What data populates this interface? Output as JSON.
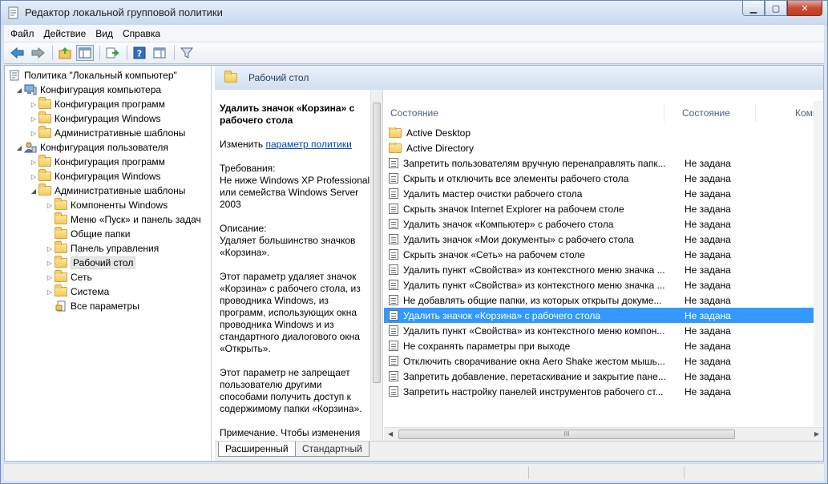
{
  "window": {
    "title": "Редактор локальной групповой политики"
  },
  "menu": {
    "file": "Файл",
    "action": "Действие",
    "view": "Вид",
    "help": "Справка"
  },
  "tree": {
    "root": "Политика \"Локальный компьютер\"",
    "computer_config": "Конфигурация компьютера",
    "cc_software": "Конфигурация программ",
    "cc_windows": "Конфигурация Windows",
    "cc_admin": "Административные шаблоны",
    "user_config": "Конфигурация пользователя",
    "uc_software": "Конфигурация программ",
    "uc_windows": "Конфигурация Windows",
    "uc_admin": "Административные шаблоны",
    "children": [
      "Компоненты Windows",
      "Меню «Пуск» и панель задач",
      "Общие папки",
      "Панель управления",
      "Рабочий стол",
      "Сеть",
      "Система",
      "Все параметры"
    ]
  },
  "right_header": {
    "title": "Рабочий стол"
  },
  "description": {
    "policy_title": "Удалить значок «Корзина» с рабочего стола",
    "edit_prefix": "Изменить",
    "edit_link": "параметр политики",
    "requirements": "Требования:\nНе ниже Windows XP Professional или семейства Windows Server 2003",
    "description_head": "Описание:\nУдаляет большинство значков «Корзина».",
    "p1": "Этот параметр удаляет значок «Корзина» с рабочего стола, из проводника Windows, из программ, использующих окна проводника Windows и из стандартного диалогового окна «Открыть».",
    "p2": "Этот параметр не запрещает пользователю другими способами получить доступ к содержимому папки «Корзина».",
    "p3": "Примечание. Чтобы изменения"
  },
  "list": {
    "col_name": "Состояние",
    "col_state": "Состояние",
    "col_comment": "Комм",
    "folders": [
      "Active Desktop",
      "Active Directory"
    ],
    "rows": [
      {
        "name": "Запретить пользователям вручную перенаправлять папк...",
        "state": "Не задана"
      },
      {
        "name": "Скрыть и отключить все элементы рабочего стола",
        "state": "Не задана"
      },
      {
        "name": "Удалить мастер очистки рабочего стола",
        "state": "Не задана"
      },
      {
        "name": "Скрыть значок Internet Explorer на рабочем столе",
        "state": "Не задана"
      },
      {
        "name": "Удалить значок «Компьютер» с рабочего стола",
        "state": "Не задана"
      },
      {
        "name": "Удалить значок «Мои документы» с рабочего стола",
        "state": "Не задана"
      },
      {
        "name": "Скрыть значок «Сеть» на рабочем столе",
        "state": "Не задана"
      },
      {
        "name": "Удалить пункт «Свойства» из контекстного меню значка ...",
        "state": "Не задана"
      },
      {
        "name": "Удалить пункт «Свойства» из контекстного меню значка ...",
        "state": "Не задана"
      },
      {
        "name": "Не добавлять общие папки, из которых открыты докуме...",
        "state": "Не задана"
      },
      {
        "name": "Удалить значок «Корзина» с рабочего стола",
        "state": "Не задана"
      },
      {
        "name": "Удалить пункт «Свойства» из контекстного меню компон...",
        "state": "Не задана"
      },
      {
        "name": "Не сохранять параметры при выходе",
        "state": "Не задана"
      },
      {
        "name": "Отключить сворачивание окна Aero Shake жестом мышь...",
        "state": "Не задана"
      },
      {
        "name": "Запретить добавление, перетаскивание и закрытие пане...",
        "state": "Не задана"
      },
      {
        "name": "Запретить настройку панелей инструментов рабочего ст...",
        "state": "Не задана"
      }
    ]
  },
  "tabs": {
    "extended": "Расширенный",
    "standard": "Стандартный"
  }
}
